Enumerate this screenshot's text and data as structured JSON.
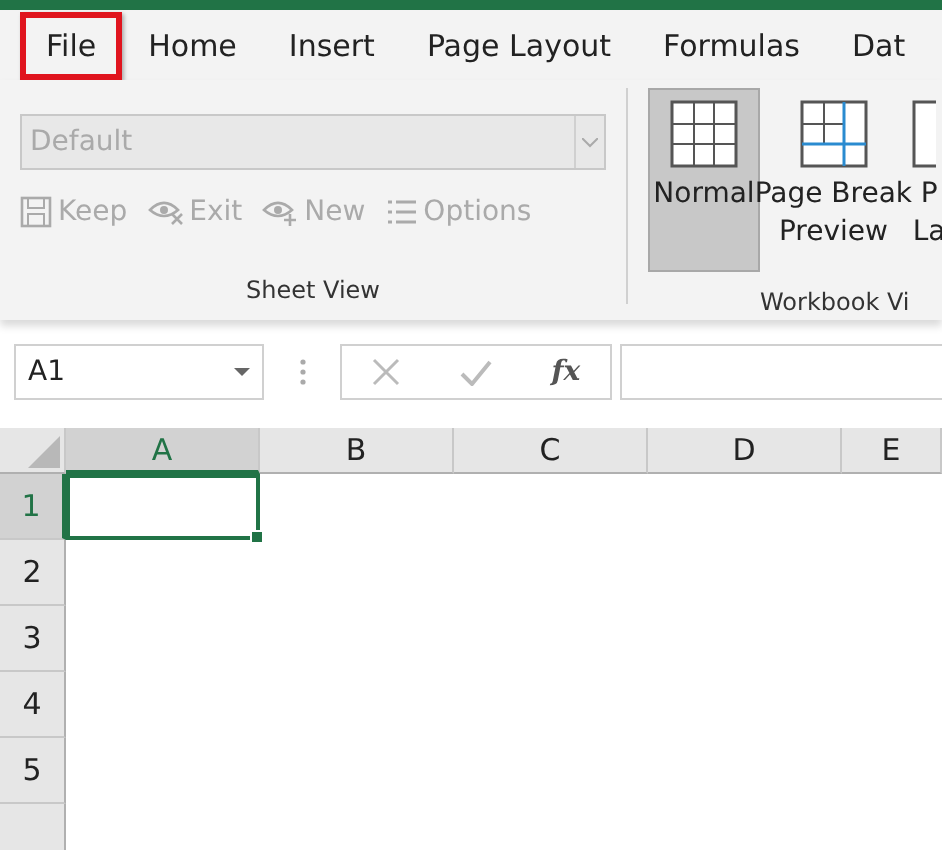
{
  "tabs": [
    {
      "label": "File",
      "highlighted": true
    },
    {
      "label": "Home",
      "highlighted": false
    },
    {
      "label": "Insert",
      "highlighted": false
    },
    {
      "label": "Page Layout",
      "highlighted": false
    },
    {
      "label": "Formulas",
      "highlighted": false
    },
    {
      "label": "Dat",
      "highlighted": false
    }
  ],
  "sheet_view": {
    "dropdown": {
      "value": "Default",
      "disabled": true
    },
    "buttons": [
      {
        "kind": "save",
        "label": "Keep",
        "disabled": true
      },
      {
        "kind": "eye-x",
        "label": "Exit",
        "disabled": true
      },
      {
        "kind": "eye-plus",
        "label": "New",
        "disabled": true
      },
      {
        "kind": "list",
        "label": "Options",
        "disabled": true
      }
    ],
    "group_label": "Sheet View"
  },
  "workbook_views": {
    "buttons": [
      {
        "kind": "normal",
        "lines": [
          "Normal"
        ],
        "selected": true
      },
      {
        "kind": "page-break",
        "lines": [
          "Page Break",
          "Preview"
        ],
        "selected": false
      },
      {
        "kind": "page-layout",
        "lines": [
          "P",
          "La"
        ],
        "selected": false
      }
    ],
    "group_label": "Workbook Vi"
  },
  "formula_bar": {
    "name_box": "A1",
    "fx": "fx"
  },
  "columns": [
    {
      "label": "A",
      "selected": true
    },
    {
      "label": "B",
      "selected": false
    },
    {
      "label": "C",
      "selected": false
    },
    {
      "label": "D",
      "selected": false
    },
    {
      "label": "E",
      "selected": false
    }
  ],
  "rows": [
    {
      "label": "1",
      "selected": true
    },
    {
      "label": "2",
      "selected": false
    },
    {
      "label": "3",
      "selected": false
    },
    {
      "label": "4",
      "selected": false
    },
    {
      "label": "5",
      "selected": false
    },
    {
      "label": "",
      "selected": false
    }
  ]
}
